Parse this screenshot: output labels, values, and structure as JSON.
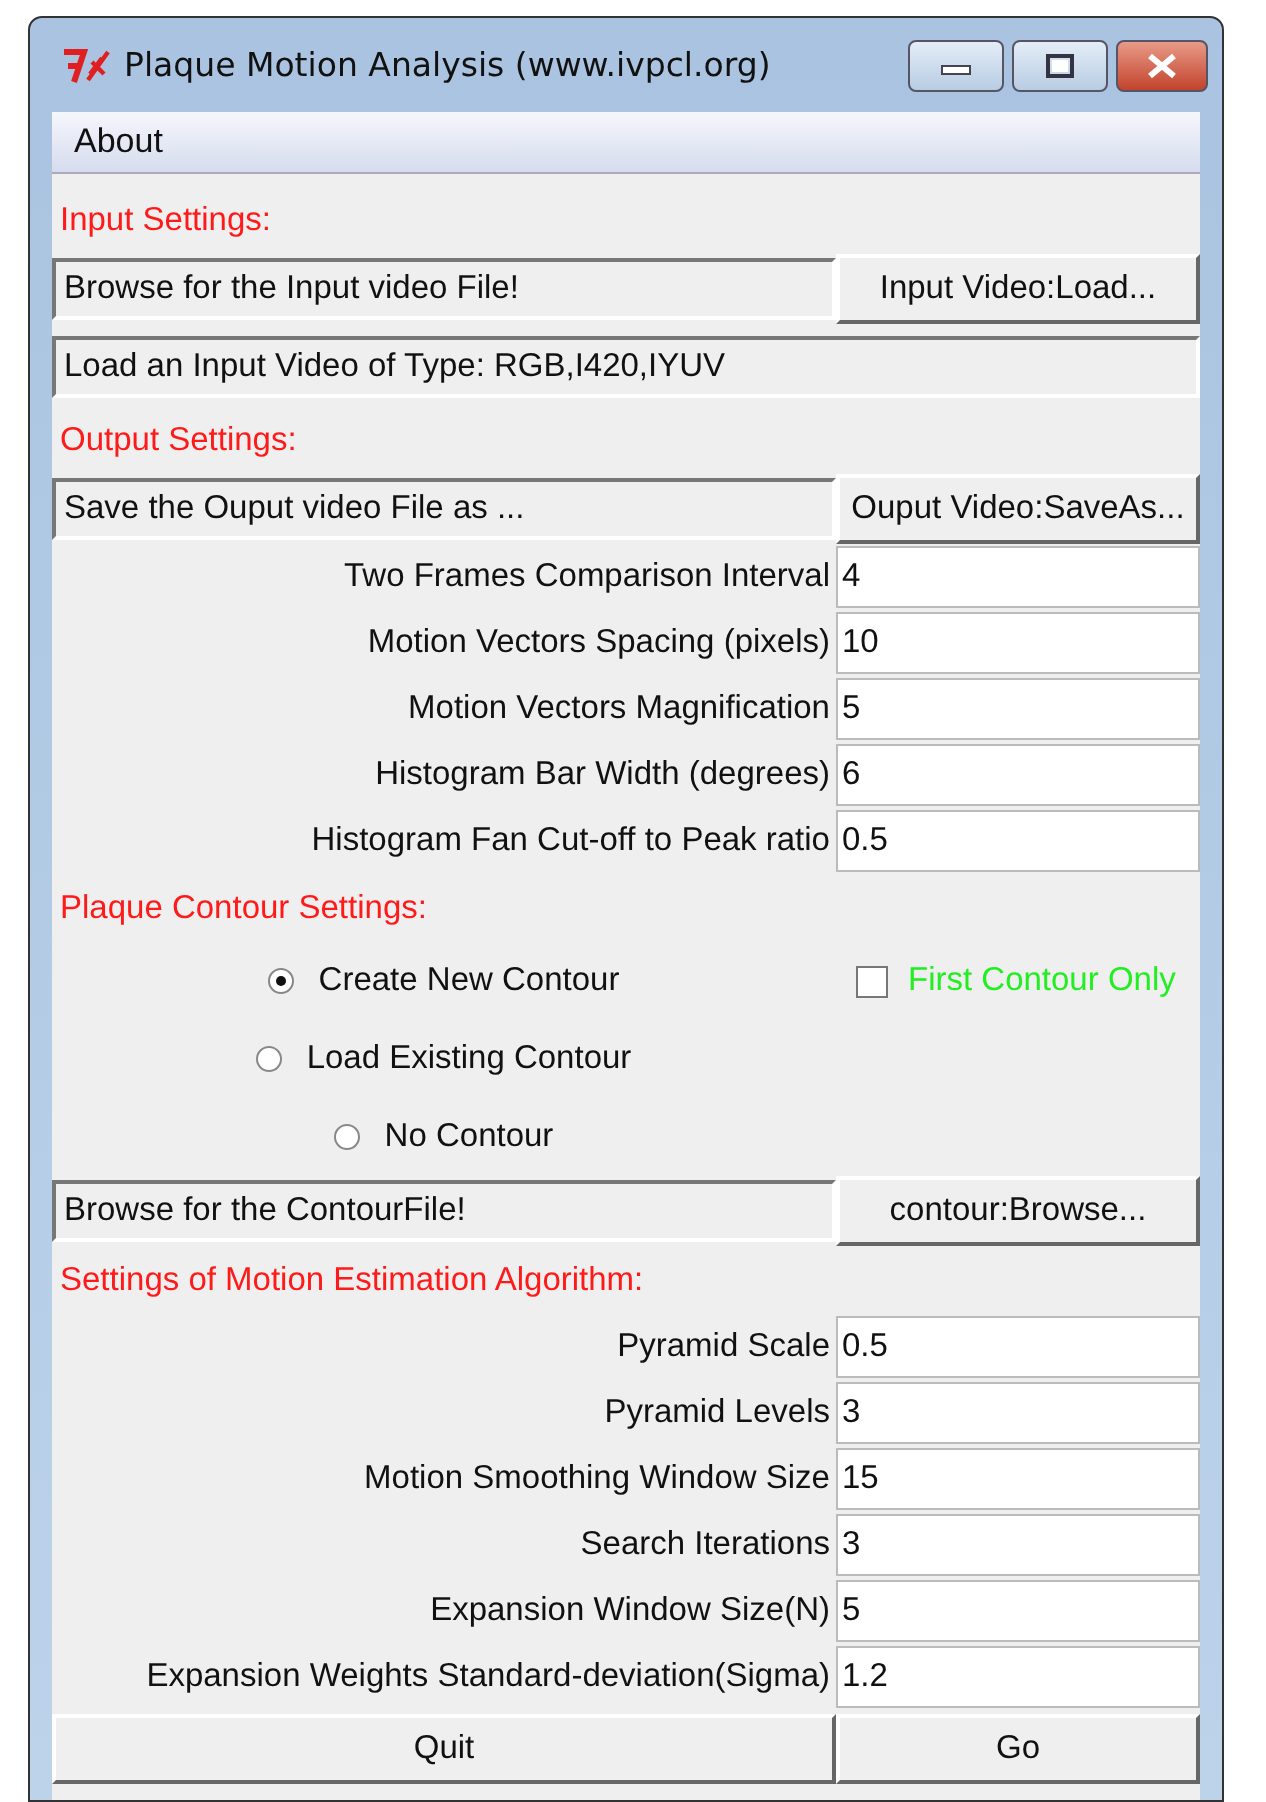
{
  "window": {
    "title": "Plaque Motion Analysis (www.ivpcl.org)"
  },
  "menu": [
    "About"
  ],
  "rows": [
    {
      "kind": "heading",
      "text": "Input Settings:"
    },
    {
      "kind": "file",
      "path": "Browse for the Input video File!",
      "button": "Input Video:Load..."
    },
    {
      "kind": "info",
      "text": "Load an Input Video of Type: RGB,I420,IYUV"
    },
    {
      "kind": "heading",
      "text": "Output Settings:"
    },
    {
      "kind": "file",
      "path": "Save the Ouput video File as ...",
      "button": "Ouput Video:SaveAs..."
    },
    {
      "kind": "param",
      "label": "Two Frames Comparison Interval",
      "value": "4"
    },
    {
      "kind": "param",
      "label": "Motion Vectors Spacing (pixels)",
      "value": "10"
    },
    {
      "kind": "param",
      "label": "Motion Vectors Magnification",
      "value": "5"
    },
    {
      "kind": "param",
      "label": "Histogram Bar Width (degrees)",
      "value": "6"
    },
    {
      "kind": "param",
      "label": "Histogram Fan Cut-off to Peak ratio",
      "value": "0.5"
    },
    {
      "kind": "heading",
      "text": "Plaque Contour Settings:"
    },
    {
      "kind": "radio",
      "label": "Create New Contour",
      "selected": true,
      "checkbox": {
        "label": "First Contour Only",
        "checked": false
      }
    },
    {
      "kind": "radio",
      "label": "Load Existing Contour",
      "selected": false
    },
    {
      "kind": "radio",
      "label": "No Contour",
      "selected": false
    },
    {
      "kind": "file",
      "path": "Browse for the ContourFile!",
      "button": "contour:Browse..."
    },
    {
      "kind": "heading",
      "text": "Settings of Motion Estimation Algorithm:"
    },
    {
      "kind": "param",
      "label": "Pyramid Scale",
      "value": "0.5"
    },
    {
      "kind": "param",
      "label": "Pyramid Levels",
      "value": "3"
    },
    {
      "kind": "param",
      "label": "Motion Smoothing Window Size",
      "value": "15"
    },
    {
      "kind": "param",
      "label": "Search Iterations",
      "value": "3"
    },
    {
      "kind": "param",
      "label": "Expansion Window Size(N)",
      "value": "5"
    },
    {
      "kind": "param",
      "label": "Expansion Weights Standard-deviation(Sigma)",
      "value": "1.2"
    },
    {
      "kind": "buttons",
      "buttons": [
        "Quit",
        "Go"
      ]
    }
  ]
}
